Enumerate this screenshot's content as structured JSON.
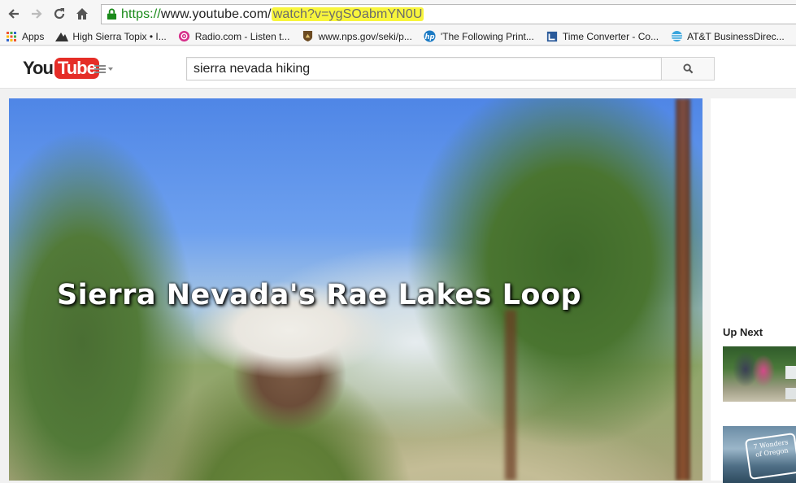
{
  "browser": {
    "url_scheme": "https://",
    "url_host": "www.youtube.com/",
    "url_path": "watch?v=ygSOabmYN0U",
    "bookmarks": [
      {
        "label": "Apps",
        "icon": "apps-grid-icon"
      },
      {
        "label": "High Sierra Topix • I...",
        "icon": "mountain-icon"
      },
      {
        "label": "Radio.com - Listen t...",
        "icon": "radio-icon"
      },
      {
        "label": "www.nps.gov/seki/p...",
        "icon": "nps-shield-icon"
      },
      {
        "label": "'The Following Print...",
        "icon": "hp-icon"
      },
      {
        "label": "Time Converter - Co...",
        "icon": "clock-icon"
      },
      {
        "label": "AT&T BusinessDirec...",
        "icon": "att-globe-icon"
      }
    ]
  },
  "youtube": {
    "logo_you": "You",
    "logo_tube": "Tube",
    "search_value": "sierra nevada hiking",
    "video_title": "Sierra Nevada's Rae Lakes Loop",
    "up_next_label": "Up Next",
    "thumb2_caption": "7 Wonders of Oregon"
  },
  "colors": {
    "url_highlight": "#f8f53c",
    "secure_green": "#1a8a1a",
    "youtube_red": "#e52d27"
  }
}
